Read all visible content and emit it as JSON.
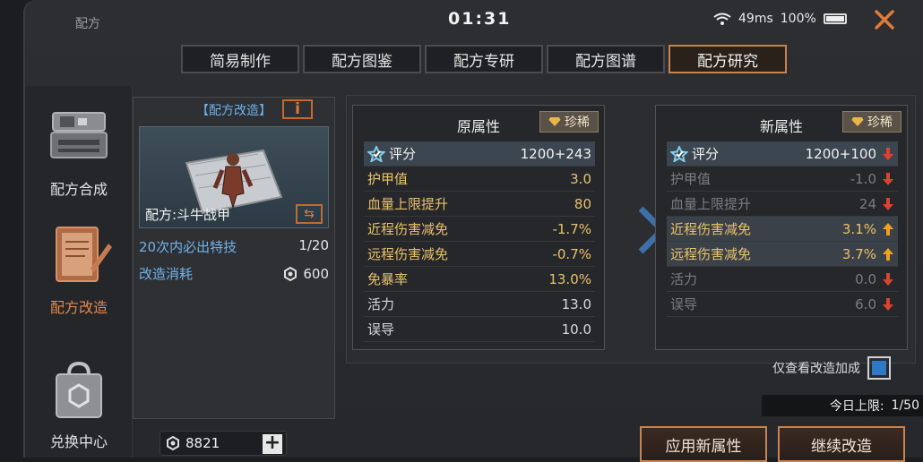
{
  "header": {
    "app_title": "配方",
    "clock": "01:31",
    "ping": "49ms",
    "battery": "100%"
  },
  "tabs": [
    {
      "label": "简易制作",
      "active": false
    },
    {
      "label": "配方图鉴",
      "active": false
    },
    {
      "label": "配方专研",
      "active": false
    },
    {
      "label": "配方图谱",
      "active": false
    },
    {
      "label": "配方研究",
      "active": true
    }
  ],
  "sidebar": {
    "items": [
      {
        "label": "配方合成",
        "icon": "machine-icon",
        "active": false
      },
      {
        "label": "配方改造",
        "icon": "notebook-pen-icon",
        "active": true
      },
      {
        "label": "兑换中心",
        "icon": "shopping-bag-icon",
        "active": false
      }
    ]
  },
  "recipe": {
    "title": "【配方改造】",
    "info_label": "i",
    "name": "配方:斗牛战甲",
    "special_label": "20次内必出特技",
    "special_value": "1/20",
    "cost_label": "改造消耗",
    "cost_value": "600"
  },
  "currency": {
    "amount": "8821",
    "add_label": "+"
  },
  "original": {
    "title": "原属性",
    "rarity": "珍稀",
    "rows": [
      {
        "name": "评分",
        "value": "1200+243",
        "style": "score"
      },
      {
        "name": "护甲值",
        "value": "3.0",
        "style": "gold"
      },
      {
        "name": "血量上限提升",
        "value": "80",
        "style": "gold"
      },
      {
        "name": "近程伤害减免",
        "value": "-1.7%",
        "style": "gold"
      },
      {
        "name": "远程伤害减免",
        "value": "-0.7%",
        "style": "gold"
      },
      {
        "name": "免暴率",
        "value": "13.0%",
        "style": "gold"
      },
      {
        "name": "活力",
        "value": "13.0",
        "style": "plain"
      },
      {
        "name": "误导",
        "value": "10.0",
        "style": "plain"
      }
    ]
  },
  "new": {
    "title": "新属性",
    "rarity": "珍稀",
    "rows": [
      {
        "name": "评分",
        "value": "1200+100",
        "style": "score",
        "trend": "down"
      },
      {
        "name": "护甲值",
        "value": "-1.0",
        "style": "down",
        "trend": "down"
      },
      {
        "name": "血量上限提升",
        "value": "24",
        "style": "down",
        "trend": "down"
      },
      {
        "name": "近程伤害减免",
        "value": "3.1%",
        "style": "up",
        "trend": "up"
      },
      {
        "name": "远程伤害减免",
        "value": "3.7%",
        "style": "up",
        "trend": "up"
      },
      {
        "name": "活力",
        "value": "0.0",
        "style": "down",
        "trend": "down"
      },
      {
        "name": "误导",
        "value": "6.0",
        "style": "down",
        "trend": "down"
      }
    ]
  },
  "filter": {
    "label": "仅查看改造加成",
    "checked": true
  },
  "daily_limit": {
    "label": "今日上限:",
    "value": "1/50"
  },
  "actions": {
    "apply_label": "应用新属性",
    "continue_label": "继续改造"
  },
  "colors": {
    "accent": "#c9834e",
    "gold": "#e9c26b",
    "blue": "#6fb2ea",
    "up": "#f0a020",
    "down": "#d9442e"
  }
}
